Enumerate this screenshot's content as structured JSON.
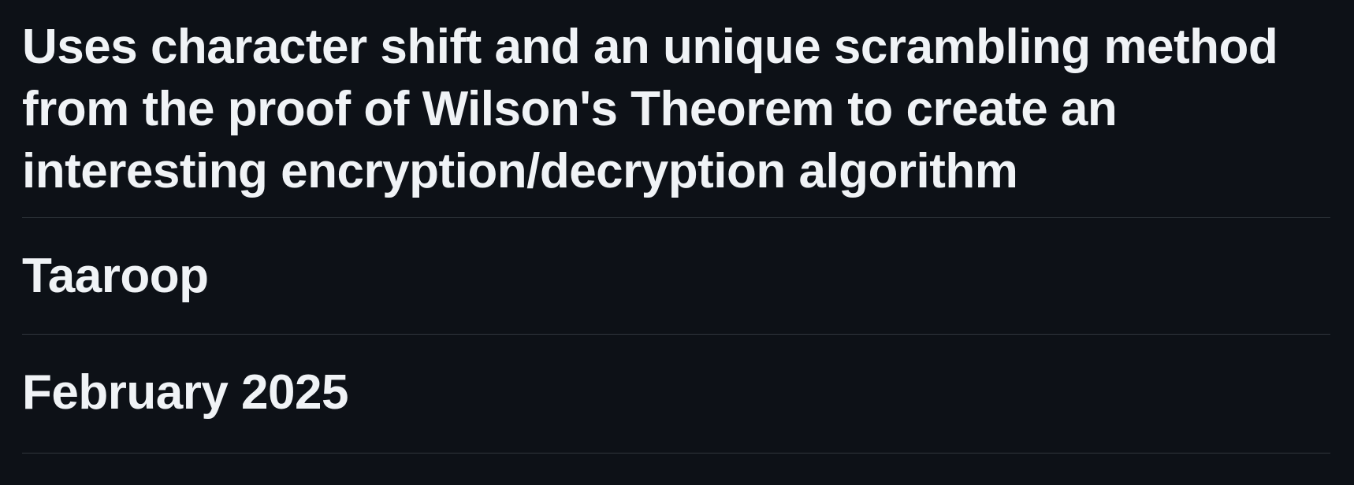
{
  "description": {
    "lines": [
      "Uses character shift and an unique scrambling method",
      "from the proof of Wilson's Theorem to create an",
      "interesting encryption/decryption algorithm"
    ]
  },
  "author": "Taaroop",
  "date": "February 2025",
  "colors": {
    "background": "#0d1117",
    "text": "#f0f3f6",
    "divider": "#30363d"
  }
}
